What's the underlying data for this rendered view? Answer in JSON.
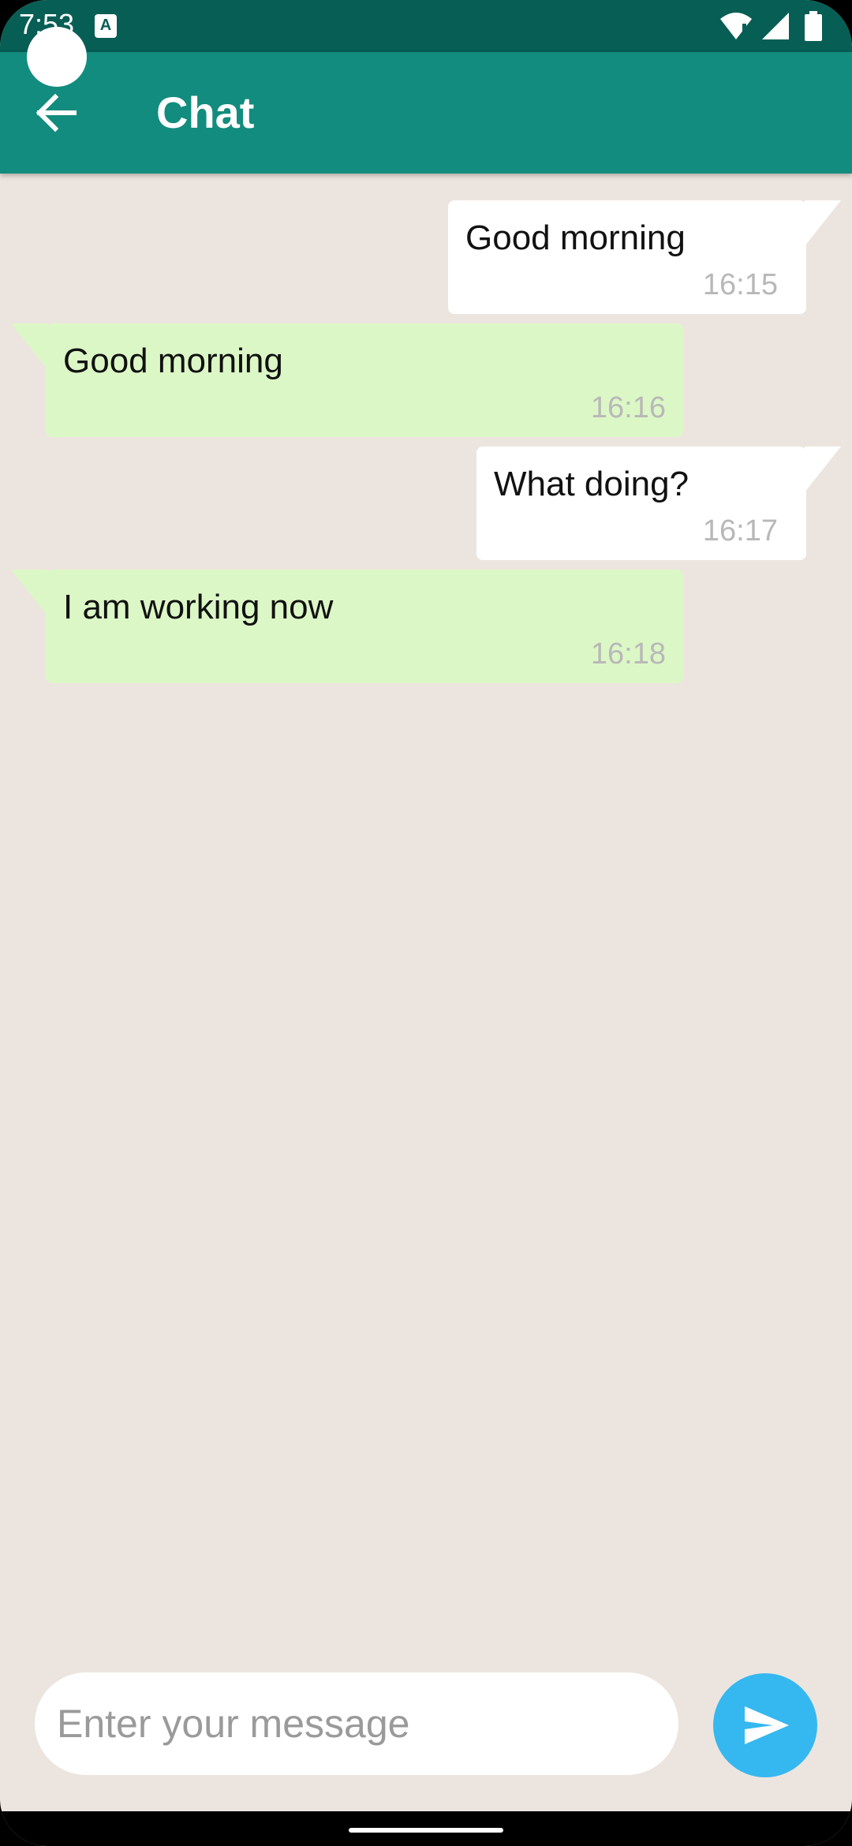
{
  "status_bar": {
    "time": "7:53",
    "keyboard_icon_letter": "A",
    "icons": [
      "wifi-icon",
      "signal-icon",
      "battery-icon"
    ]
  },
  "app_bar": {
    "title": "Chat",
    "back_icon": "arrow-left-icon"
  },
  "messages": [
    {
      "direction": "sent",
      "text": "Good morning",
      "time": "16:15"
    },
    {
      "direction": "received",
      "text": "Good morning",
      "time": "16:16"
    },
    {
      "direction": "sent",
      "text": "What doing?",
      "time": "16:17"
    },
    {
      "direction": "received",
      "text": "I am working now",
      "time": "16:18"
    }
  ],
  "composer": {
    "placeholder": "Enter your message",
    "value": "",
    "send_icon": "send-icon"
  },
  "colors": {
    "status_bar": "#075e55",
    "app_bar": "#128c7e",
    "chat_background": "#ece5df",
    "sent_bubble": "#ffffff",
    "received_bubble": "#dcf7c6",
    "send_button": "#35b8ef"
  }
}
